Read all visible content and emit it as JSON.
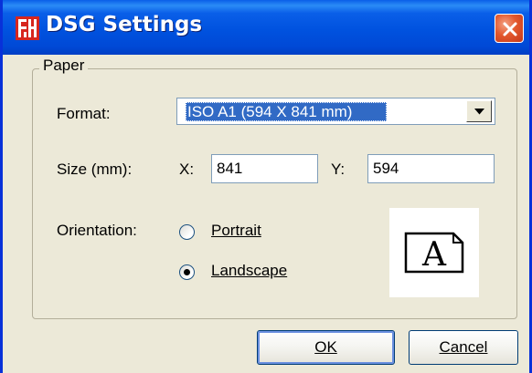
{
  "window": {
    "title": "DSG Settings"
  },
  "paper_group": {
    "label": "Paper"
  },
  "format": {
    "label": "Format:",
    "selected": "ISO A1 (594 X 841 mm)"
  },
  "size": {
    "label": "Size (mm):",
    "x_label": "X:",
    "x_value": "841",
    "y_label": "Y:",
    "y_value": "594"
  },
  "orientation": {
    "label": "Orientation:",
    "portrait_label": "Portrait",
    "landscape_label": "Landscape",
    "selected": "Landscape",
    "preview_letter": "A"
  },
  "buttons": {
    "ok": "OK",
    "cancel": "Cancel"
  },
  "colors": {
    "titlebar": "#0052df",
    "dialog_bg": "#ece9d8",
    "selection": "#316ac5",
    "close_button": "#e3582d"
  },
  "icons": {
    "app": "dsg-app-icon",
    "close": "close-icon",
    "dropdown": "chevron-down-icon",
    "preview": "landscape-page-icon"
  }
}
